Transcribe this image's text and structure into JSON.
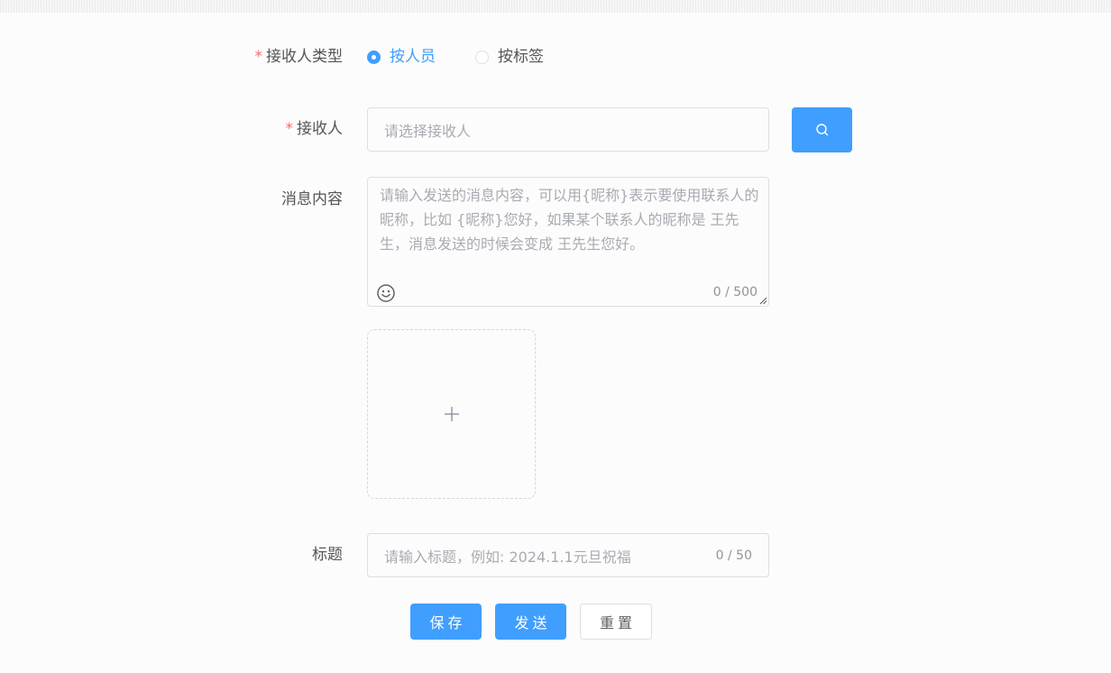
{
  "form": {
    "receiver_type": {
      "label": "接收人类型",
      "options": [
        {
          "label": "按人员",
          "checked": true
        },
        {
          "label": "按标签",
          "checked": false
        }
      ]
    },
    "receiver": {
      "label": "接收人",
      "placeholder": "请选择接收人",
      "search_icon": "search-icon"
    },
    "message": {
      "label": "消息内容",
      "placeholder": "请输入发送的消息内容，可以用{昵称}表示要使用联系人的昵称，比如 {昵称}您好，如果某个联系人的昵称是 王先生，消息发送的时候会变成 王先生您好。",
      "counter": "0 / 500",
      "emoji_icon": "smile-icon"
    },
    "upload": {
      "icon": "plus-icon"
    },
    "title": {
      "label": "标题",
      "placeholder": "请输入标题，例如: 2024.1.1元旦祝福",
      "counter": "0 / 50"
    },
    "buttons": {
      "save": "保存",
      "send": "发送",
      "reset": "重置"
    }
  },
  "colors": {
    "primary": "#409eff",
    "required": "#f56c6c",
    "border": "#dcdfe6",
    "placeholder": "#a8abb2"
  }
}
